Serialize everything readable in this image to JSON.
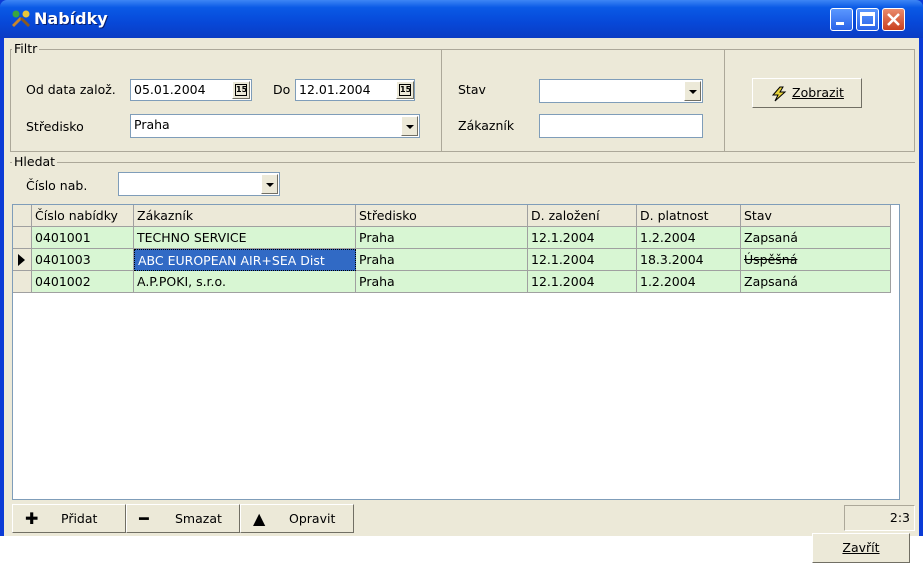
{
  "window": {
    "title": "Nabídky"
  },
  "filter": {
    "group_label": "Filtr",
    "from_label": "Od data založ.",
    "from_value": "05.01.2004",
    "to_label": "Do",
    "to_value": "12.01.2004",
    "calendar_glyph": "15",
    "center_label": "Středisko",
    "center_value": "Praha",
    "state_label": "Stav",
    "state_value": "",
    "customer_label": "Zákazník",
    "customer_value": "",
    "show_button": "Zobrazit"
  },
  "search": {
    "group_label": "Hledat",
    "number_label": "Číslo nab.",
    "number_value": ""
  },
  "grid": {
    "columns": [
      "Číslo nabídky",
      "Zákazník",
      "Středisko",
      "D. založení",
      "D. platnost",
      "Stav"
    ],
    "rows": [
      [
        "0401001",
        "TECHNO SERVICE",
        "Praha",
        "12.1.2004",
        "1.2.2004",
        "Zapsaná"
      ],
      [
        "0401003",
        "ABC EUROPEAN AIR+SEA Dist",
        "Praha",
        "12.1.2004",
        "18.3.2004",
        "Úspěšná"
      ],
      [
        "0401002",
        "A.P.POKI, s.r.o.",
        "Praha",
        "12.1.2004",
        "1.2.2004",
        "Zapsaná"
      ]
    ]
  },
  "toolbar": {
    "add_label": "Přidat",
    "delete_label": "Smazat",
    "edit_label": "Opravit",
    "record_position": "2:3",
    "close_label": "Zavřít"
  },
  "colors": {
    "row_background": "#d8f6d3",
    "selection": "#316ac5",
    "titlebar": "#0748d8"
  }
}
